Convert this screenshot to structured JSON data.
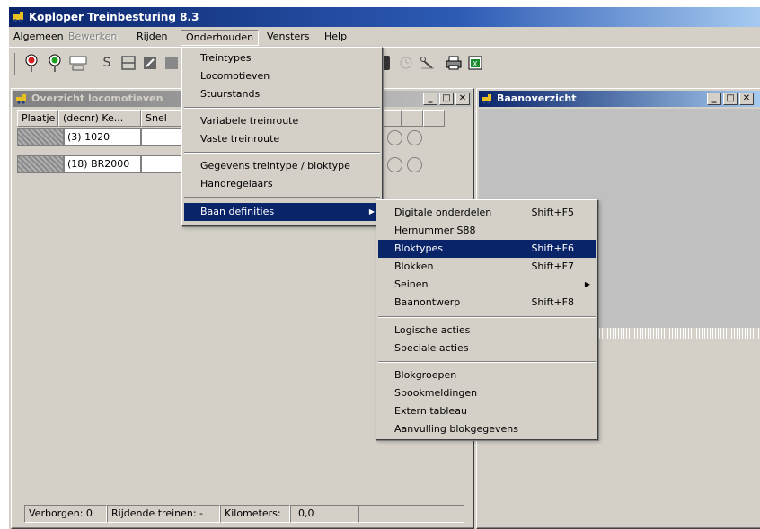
{
  "app": {
    "title": "Koploper Treinbesturing 8.3"
  },
  "menubar": [
    "Algemeen",
    "Bewerken",
    "Rijden",
    "Onderhouden",
    "Vensters",
    "Help"
  ],
  "toolbar": {
    "s_label": "S"
  },
  "loco_window": {
    "title": "Overzicht locomotieven",
    "columns": [
      "Plaatje",
      "(decnr) Ke...",
      "Snel"
    ],
    "rows": [
      {
        "name": "(3) 1020"
      },
      {
        "name": "(18) BR2000"
      }
    ],
    "status": {
      "hidden": "Verborgen: 0",
      "driving": "Rijdende treinen: -",
      "km_label": "Kilometers:",
      "km_value": "0,0"
    }
  },
  "baan_window": {
    "title": "Baanoverzicht"
  },
  "onderhouden_menu": {
    "group1": [
      "Treintypes",
      "Locomotieven",
      "Stuurstands"
    ],
    "group2": [
      "Variabele treinroute",
      "Vaste treinroute"
    ],
    "group3": [
      "Gegevens treintype / bloktype",
      "Handregelaars"
    ],
    "group4": [
      "Baan definities"
    ]
  },
  "baan_definities_menu": {
    "group1": [
      {
        "label": "Digitale onderdelen",
        "shortcut": "Shift+F5"
      },
      {
        "label": "Hernummer S88",
        "shortcut": ""
      },
      {
        "label": "Bloktypes",
        "shortcut": "Shift+F6"
      },
      {
        "label": "Blokken",
        "shortcut": "Shift+F7"
      },
      {
        "label": "Seinen",
        "shortcut": ""
      },
      {
        "label": "Baanontwerp",
        "shortcut": "Shift+F8"
      }
    ],
    "group2": [
      "Logische acties",
      "Speciale acties"
    ],
    "group3": [
      "Blokgroepen",
      "Spookmeldingen",
      "Extern tableau",
      "Aanvulling blokgegevens"
    ]
  },
  "colors": {
    "highlight": "#0a246a",
    "face": "#d4d0c8"
  }
}
